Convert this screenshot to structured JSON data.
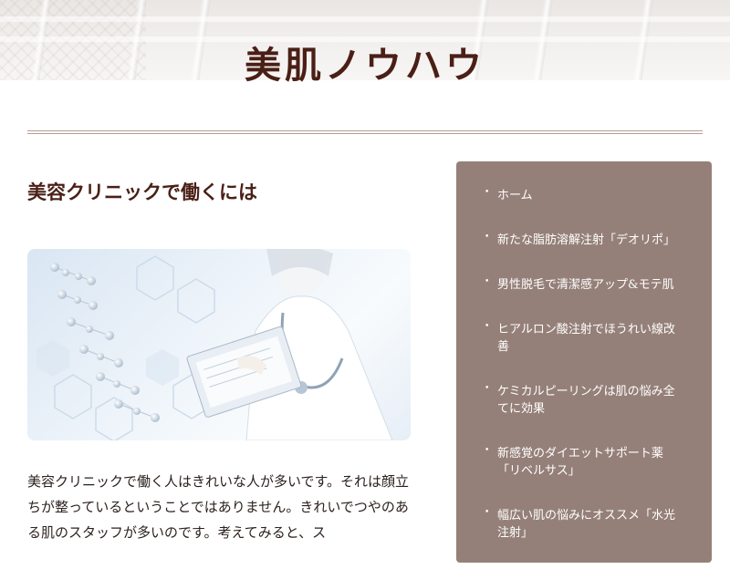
{
  "site": {
    "title": "美肌ノウハウ"
  },
  "article": {
    "title": "美容クリニックで働くには",
    "image_alt": "doctor-with-dna-image",
    "body": "美容クリニックで働く人はきれいな人が多いです。それは顔立ちが整っているということではありません。きれいでつやのある肌のスタッフが多いのです。考えてみると、ス"
  },
  "sidebar": {
    "items": [
      {
        "label": "ホーム"
      },
      {
        "label": "新たな脂肪溶解注射「デオリポ」"
      },
      {
        "label": "男性脱毛で清潔感アップ&モテ肌"
      },
      {
        "label": "ヒアルロン酸注射でほうれい線改善"
      },
      {
        "label": "ケミカルピーリングは肌の悩み全てに効果"
      },
      {
        "label": "新感覚のダイエットサポート薬「リベルサス」"
      },
      {
        "label": "幅広い肌の悩みにオススメ「水光注射」"
      }
    ]
  },
  "colors": {
    "title": "#4a1f16",
    "sidebar_bg": "#958079",
    "divider": "#b79d93"
  }
}
